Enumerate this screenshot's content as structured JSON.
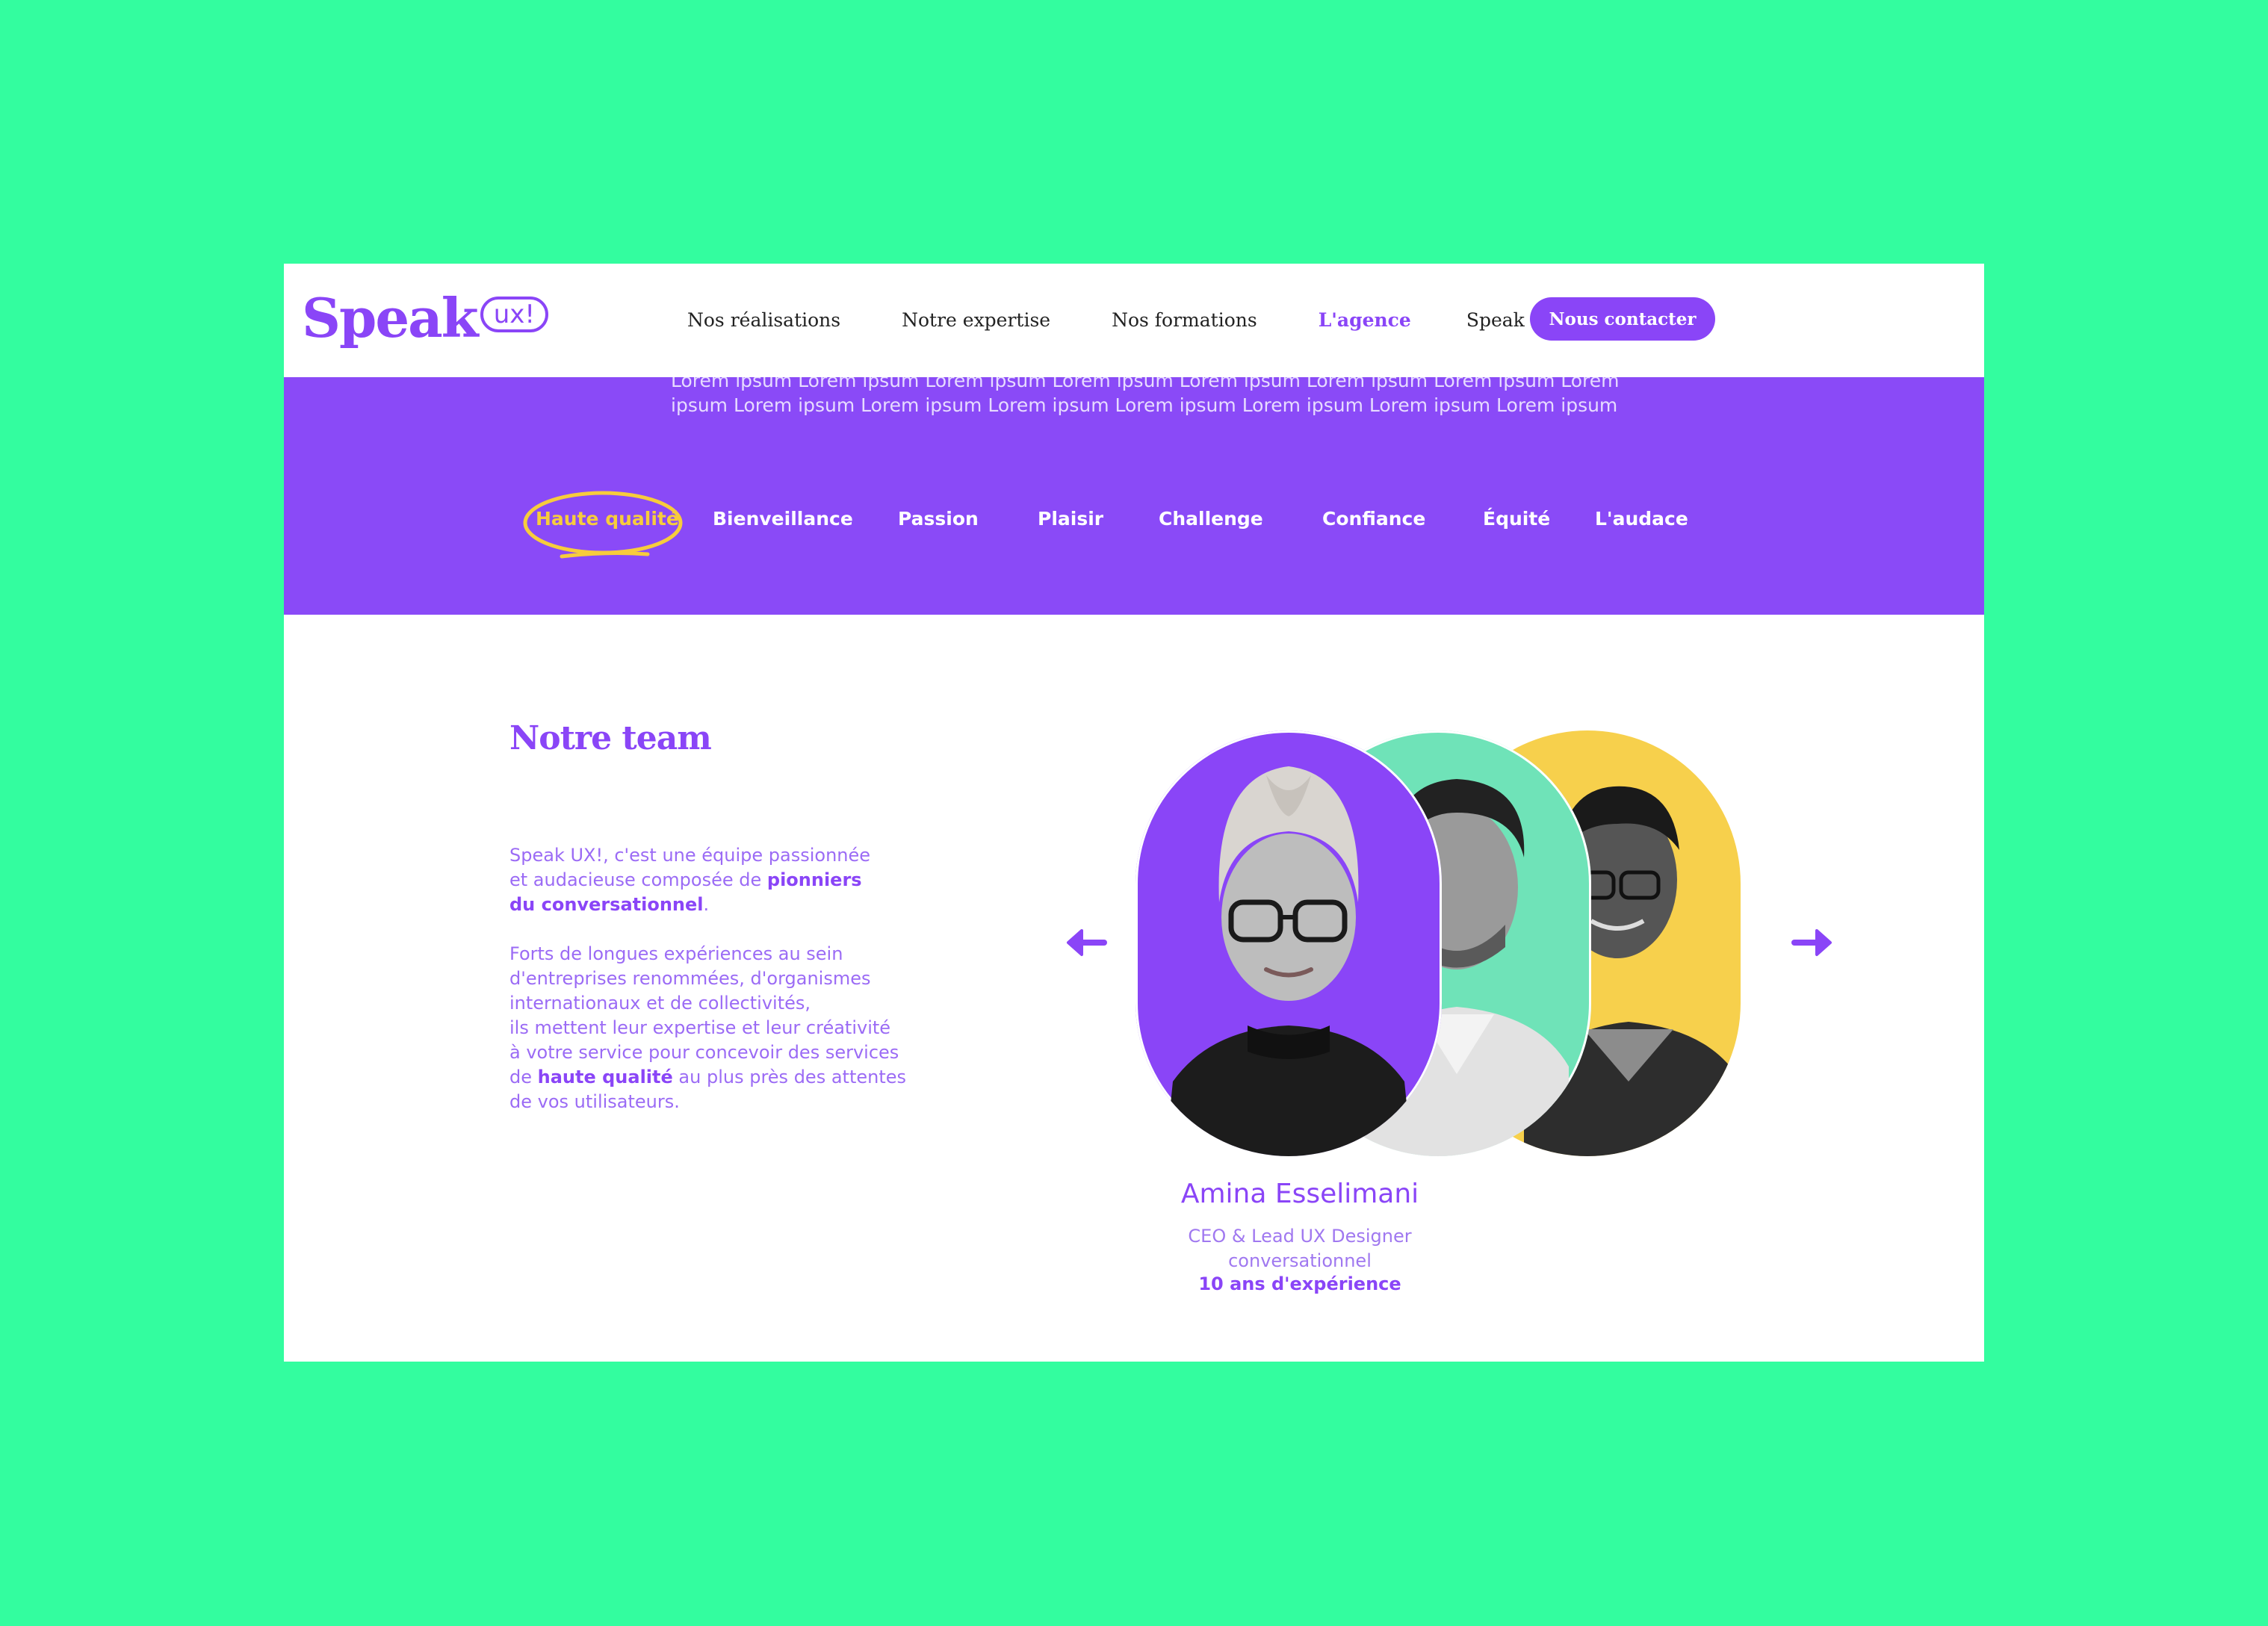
{
  "colors": {
    "background": "#33fd9f",
    "brand_purple": "#8a45f7",
    "highlight_yellow": "#f7cc3c",
    "mint": "#6fe3b8",
    "yellow_card": "#f7d04c"
  },
  "brand": {
    "name": "Speak",
    "badge": "ux!"
  },
  "nav": {
    "items": [
      "Nos réalisations",
      "Notre expertise",
      "Nos formations",
      "L'agence",
      "Speak Blog"
    ],
    "active": "L'agence",
    "cta": "Nous contacter"
  },
  "band": {
    "lorem_line_1": "Lorem ipsum Lorem ipsum Lorem ipsum Lorem ipsum Lorem ipsum Lorem ipsum Lorem ipsum Lorem",
    "lorem_line_2": "ipsum Lorem ipsum Lorem ipsum Lorem ipsum Lorem ipsum Lorem ipsum Lorem ipsum Lorem ipsum"
  },
  "values": {
    "items": [
      "Haute qualité",
      "Bienveillance",
      "Passion",
      "Plaisir",
      "Challenge",
      "Confiance",
      "Équité",
      "L'audace"
    ],
    "active": "Haute qualité"
  },
  "team": {
    "title": "Notre team",
    "intro_1": "Speak UX!, c'est une équipe passionnée",
    "intro_2": "et audacieuse composée de",
    "intro_bold_1": "pionniers",
    "intro_bold_2": "du conversationnel",
    "intro_end": ".",
    "body_1": "Forts de longues expériences au sein",
    "body_2": "d'entreprises renommées, d'organismes",
    "body_3": "internationaux et de collectivités,",
    "body_4": "ils mettent leur expertise et leur créativité",
    "body_5": "à votre service pour concevoir des services",
    "body_6_pre": "de",
    "body_6_bold": "haute qualité",
    "body_6_post": "au plus près des attentes",
    "body_7": "de vos utilisateurs.",
    "prev_icon": "arrow-left-icon",
    "next_icon": "arrow-right-icon"
  },
  "member": {
    "name": "Amina Esselimani",
    "role_1": "CEO & Lead UX Designer",
    "role_2": "conversationnel",
    "experience": "10 ans d'expérience"
  }
}
